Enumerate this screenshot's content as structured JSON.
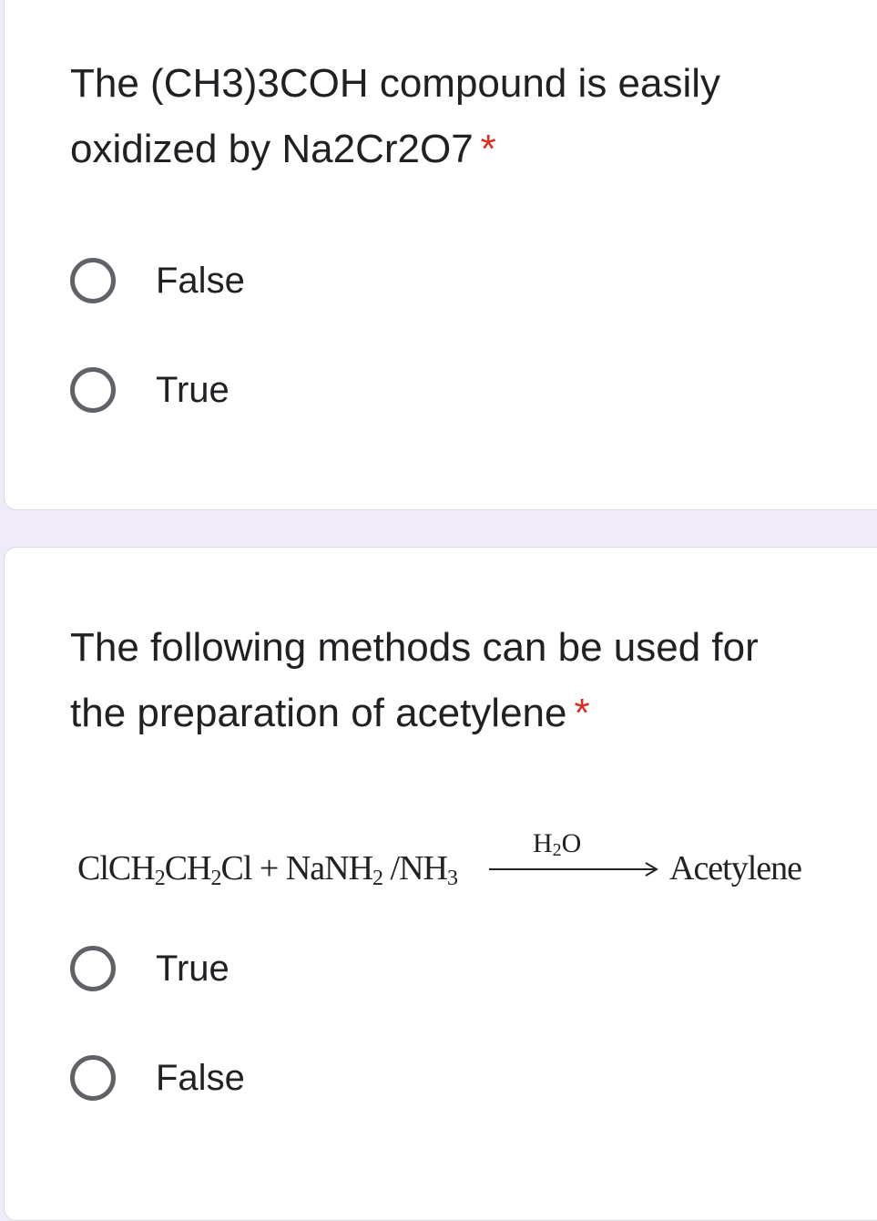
{
  "questions": [
    {
      "text": "The (CH3)3COH compound is easily oxidized by Na2Cr2O7",
      "required_marker": "*",
      "options": [
        "False",
        "True"
      ]
    },
    {
      "text": "The following methods can be used for the preparation of acetylene",
      "required_marker": "*",
      "equation": {
        "reactant_parts": [
          "ClCH",
          "2",
          "CH",
          "2",
          "Cl + NaNH",
          "2",
          " /NH",
          "3"
        ],
        "condition_parts": [
          "H",
          "2",
          "O"
        ],
        "product": "Acetylene"
      },
      "options": [
        "True",
        "False"
      ]
    }
  ],
  "colors": {
    "page_background": "#efebf8",
    "card_background": "#ffffff",
    "required": "#d93025",
    "radio_border": "#5f6368",
    "text": "#202124"
  }
}
